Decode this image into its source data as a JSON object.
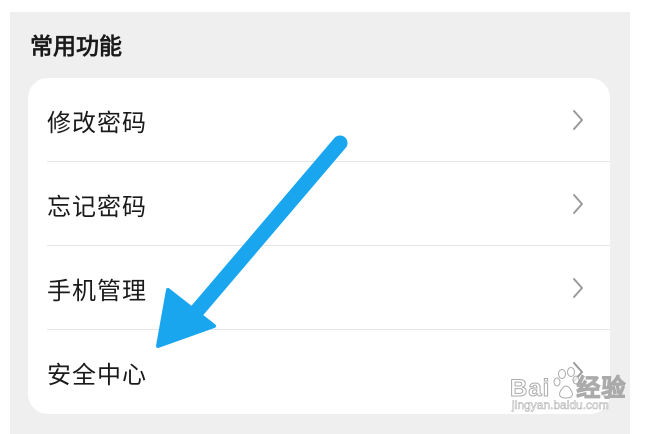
{
  "section": {
    "title": "常用功能"
  },
  "menu": {
    "items": [
      {
        "label": "修改密码",
        "icon": "chevron-right-icon"
      },
      {
        "label": "忘记密码",
        "icon": "chevron-right-icon"
      },
      {
        "label": "手机管理",
        "icon": "chevron-right-icon"
      },
      {
        "label": "安全中心",
        "icon": "chevron-right-icon"
      }
    ]
  },
  "annotation": {
    "arrow_color": "#1aa6ef",
    "icon": "arrow-annotation-icon"
  },
  "watermark": {
    "brand": "Bai",
    "brand2": "经验",
    "url": "jingyan.baidu.com"
  }
}
